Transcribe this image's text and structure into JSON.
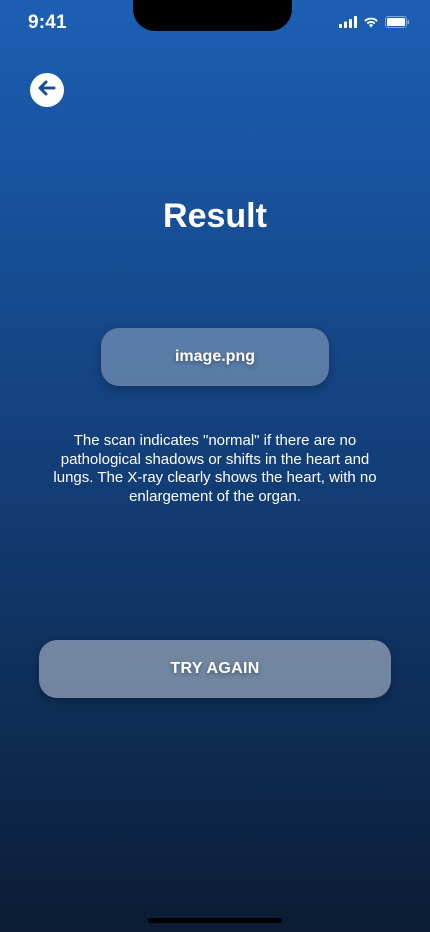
{
  "status_bar": {
    "time": "9:41",
    "icons": [
      "cellular-signal-icon",
      "wifi-icon",
      "battery-icon"
    ]
  },
  "header": {
    "back_icon": "arrow-left-icon"
  },
  "title": "Result",
  "file": {
    "name": "image.png"
  },
  "result": {
    "description": "The scan indicates \"normal\" if there are no pathological shadows or shifts in the heart and lungs. The X-ray clearly shows the heart, with no enlargement of the organ."
  },
  "actions": {
    "try_again_label": "TRY AGAIN"
  },
  "colors": {
    "background_top": "#1c5fb3",
    "background_bottom": "#0b1c33",
    "text": "#ffffff"
  }
}
